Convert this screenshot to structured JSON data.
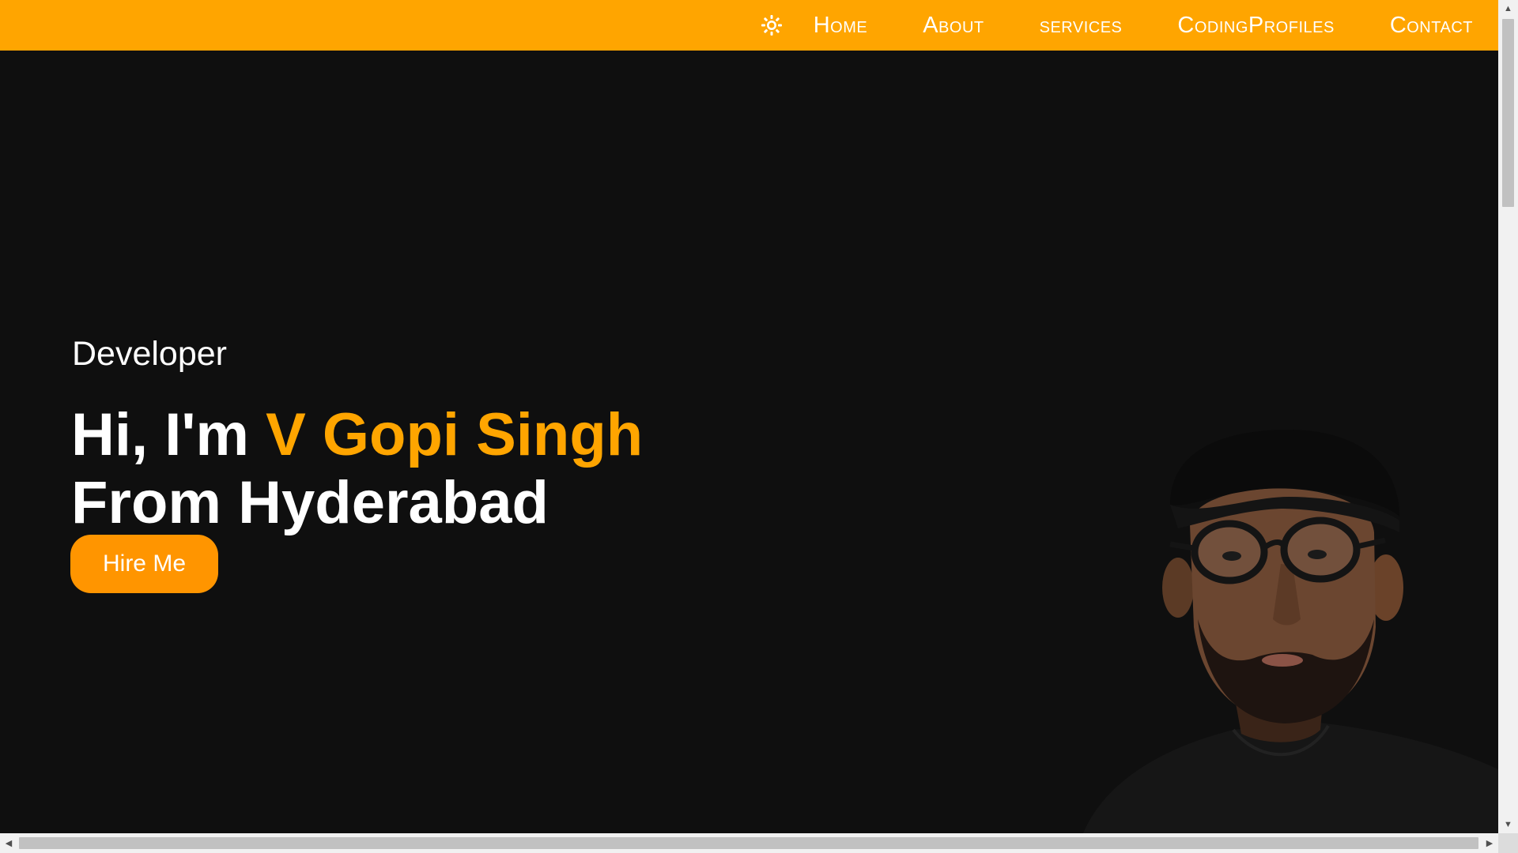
{
  "nav": {
    "theme_icon": "sun-icon",
    "links": [
      "Home",
      "About",
      "services",
      "CodingProfiles",
      "Contact"
    ]
  },
  "hero": {
    "role": "Developer",
    "greeting": "Hi, I'm ",
    "name": "V Gopi Singh",
    "location_line": "From Hyderabad",
    "cta_label": "Hire Me"
  },
  "colors": {
    "accent": "#ffa500",
    "button": "#ff9500",
    "background": "#0f0f0f",
    "text": "#ffffff"
  },
  "scrollbars": {
    "vertical": {
      "up_icon": "arrow-up-icon",
      "down_icon": "arrow-down-icon"
    },
    "horizontal": {
      "left_icon": "arrow-left-icon",
      "right_icon": "arrow-right-icon"
    }
  }
}
